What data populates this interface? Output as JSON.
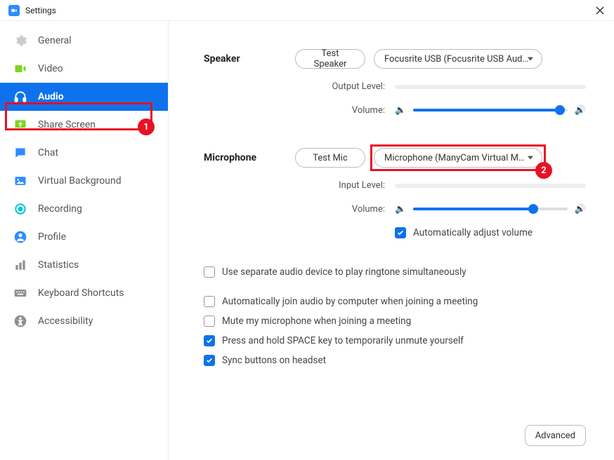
{
  "window": {
    "title": "Settings"
  },
  "sidebar": {
    "items": [
      {
        "label": "General",
        "icon": "gear"
      },
      {
        "label": "Video",
        "icon": "video"
      },
      {
        "label": "Audio",
        "icon": "headphones",
        "active": true
      },
      {
        "label": "Share Screen",
        "icon": "share"
      },
      {
        "label": "Chat",
        "icon": "chat"
      },
      {
        "label": "Virtual Background",
        "icon": "image"
      },
      {
        "label": "Recording",
        "icon": "record"
      },
      {
        "label": "Profile",
        "icon": "profile"
      },
      {
        "label": "Statistics",
        "icon": "stats"
      },
      {
        "label": "Keyboard Shortcuts",
        "icon": "keyboard"
      },
      {
        "label": "Accessibility",
        "icon": "accessibility"
      }
    ]
  },
  "annotations": {
    "badge1": "1",
    "badge2": "2"
  },
  "speaker": {
    "heading": "Speaker",
    "testLabel": "Test Speaker",
    "device": "Focusrite USB (Focusrite USB Aud…",
    "outputLevelLabel": "Output Level:",
    "volumeLabel": "Volume:",
    "volumePercent": 95
  },
  "microphone": {
    "heading": "Microphone",
    "testLabel": "Test Mic",
    "device": "Microphone (ManyCam Virtual M…",
    "inputLevelLabel": "Input Level:",
    "volumeLabel": "Volume:",
    "volumePercent": 78,
    "autoAdjust": {
      "checked": true,
      "label": "Automatically adjust volume"
    }
  },
  "options": {
    "separateRingtone": {
      "checked": false,
      "label": "Use separate audio device to play ringtone simultaneously"
    },
    "autoJoinAudio": {
      "checked": false,
      "label": "Automatically join audio by computer when joining a meeting"
    },
    "muteOnJoin": {
      "checked": false,
      "label": "Mute my microphone when joining a meeting"
    },
    "pushToTalk": {
      "checked": true,
      "label": "Press and hold SPACE key to temporarily unmute yourself"
    },
    "syncHeadset": {
      "checked": true,
      "label": "Sync buttons on headset"
    }
  },
  "advancedLabel": "Advanced"
}
